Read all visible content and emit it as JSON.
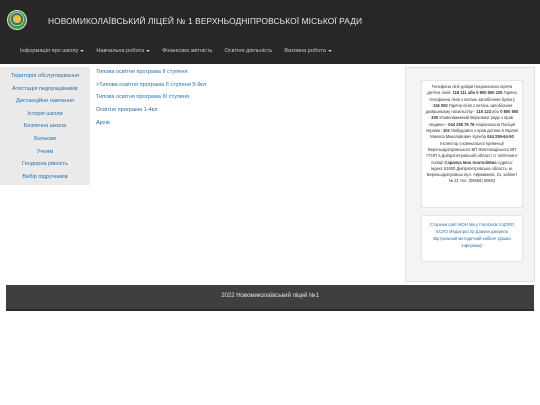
{
  "header": {
    "title": "НОВОМИКОЛАЇВСЬКИЙ ЛІЦЕЙ № 1 ВЕРХНЬОДНІПРОВСЬКОЇ МІСЬКОЇ РАДИ",
    "menu": [
      {
        "label": "Інформація про школу",
        "dropdown": true
      },
      {
        "label": "Навчальна робота",
        "dropdown": true
      },
      {
        "label": "Фінансова звітність",
        "dropdown": false
      },
      {
        "label": "Освітня діяльність",
        "dropdown": false
      },
      {
        "label": "Виховна робота",
        "dropdown": true
      }
    ]
  },
  "sidebar": {
    "items": [
      "Територія обслуговування",
      "Атестація педпрацівників",
      "Дистанційне навчання",
      "Історія школи",
      "Безпечна школа",
      "Батькам",
      "Учням",
      "Гендерна рівність",
      "Вибір підручників"
    ]
  },
  "content": {
    "links": [
      "Типова освітня програма ІІ ступеня",
      ">Типова освітня програма ІІ ступеня 5-9кл",
      "Типова освітня програма ІІІ ступеня",
      "Освітня програма 1-4кл",
      "Архів"
    ]
  },
  "info": {
    "p1": "Телефони лінії довіри Національна гаряча дитяча лінія:",
    "p1b": "116 111 або 0 800 500 225",
    "p2": "Гаряча телефонна лінія з питань запобігання булінгу -",
    "p2b": "116 000",
    "p3": "Гаряча лінія з питань запобігання домашньому насильству -",
    "p3b": "116 123",
    "p3c": "або",
    "p3d": "0 800 500 335",
    "p4": "Уповноважений Верховної ради з прав людини –",
    "p4b": "044 255 76 76",
    "p5": "Національна Поліція України -",
    "p5b": "102",
    "p6": "Омбудсмен з прав дитини в Україні Микола Миколайович Кулеба",
    "p6b": "044 255-64-50",
    "p7": "Інспектор з ювенальної превенції Верхньодніпровського ВП Жовтоводського ВП ГУНП в Дніпропетровській області ст лейтенант поліції",
    "p7b": "Саранча Інна Анатоліївна",
    "p8": "Адреса: індекс 51600 Дніпропетровська область, м. Верхньодніпровськ вул. Аврамиина, 21, кабінет № 21 тел. (05658) 60602"
  },
  "links_box": {
    "text": "Сторінки сайт МОН Ми у Facebook УЦОЯО ЄСУО Медіапростір Дзвони джерела Віртуальний методичний кабінет Дошка інформації"
  },
  "footer": {
    "text": "2022 Новомиколаївський ліцей №1"
  }
}
